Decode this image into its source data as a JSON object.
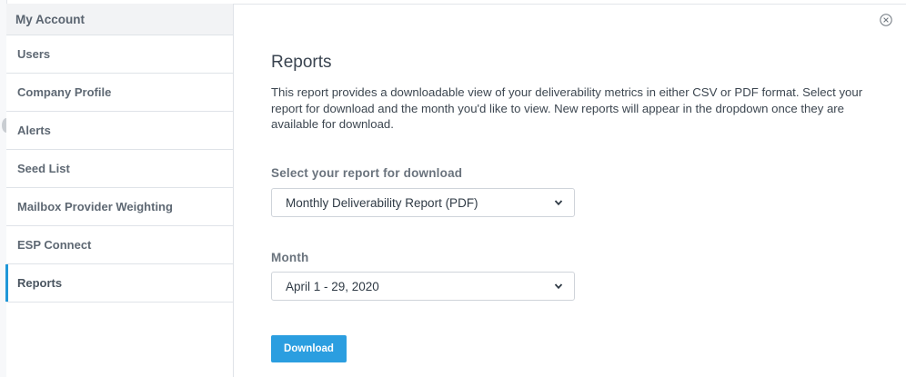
{
  "sidebar": {
    "header": "My Account",
    "items": [
      {
        "label": "Users"
      },
      {
        "label": "Company Profile"
      },
      {
        "label": "Alerts"
      },
      {
        "label": "Seed List"
      },
      {
        "label": "Mailbox Provider Weighting"
      },
      {
        "label": "ESP Connect"
      },
      {
        "label": "Reports"
      }
    ],
    "active_item": "Reports"
  },
  "main": {
    "title": "Reports",
    "description": "This report provides a downloadable view of your deliverability metrics in either CSV or PDF format. Select your report for download and the month you'd like to view. New reports will appear in the dropdown once they are available for download.",
    "report_select": {
      "label": "Select your report for download",
      "value": "Monthly Deliverability Report (PDF)"
    },
    "month_select": {
      "label": "Month",
      "value": "April 1 - 29, 2020"
    },
    "download_label": "Download"
  },
  "icons": {
    "close": "close-circle-icon",
    "dropdown": "chevron-down-icon"
  },
  "colors": {
    "accent": "#2b9ee0",
    "active_indicator": "#1f97d8",
    "sidebar_header_bg": "#f2f3f5"
  }
}
